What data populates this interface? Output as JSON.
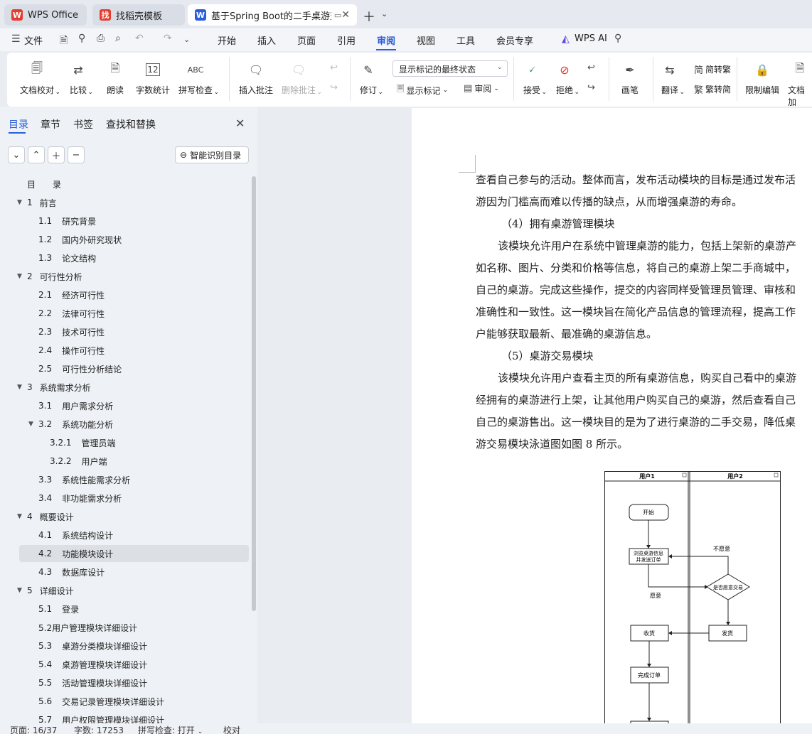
{
  "tabs": [
    {
      "label": "WPS Office",
      "logo": "W"
    },
    {
      "label": "找稻壳模板",
      "logo": "找"
    },
    {
      "label": "基于Spring Boot的二手桌游交",
      "logo": "W"
    }
  ],
  "menu": [
    "文件",
    "开始",
    "插入",
    "页面",
    "引用",
    "审阅",
    "视图",
    "工具",
    "会员专享",
    "WPS AI"
  ],
  "ribbon": {
    "doc_check": "文档校对",
    "compare": "比较",
    "read_aloud": "朗读",
    "word_count": "字数统计",
    "word_count_icon": "12",
    "spell_check": "拼写检查",
    "spell_icon": "ABC",
    "insert_comment": "插入批注",
    "delete_comment": "删除批注",
    "revise": "修订",
    "show_markup_select": "显示标记的最终状态",
    "show_markup": "显示标记",
    "review": "审阅",
    "accept": "接受",
    "reject": "拒绝",
    "draw": "画笔",
    "translate": "翻译",
    "to_traditional": "简转繁",
    "to_simplified": "繁转简",
    "restrict_edit": "限制编辑",
    "doc_extra": "文档加"
  },
  "sidebar": {
    "tabs": [
      "目录",
      "章节",
      "书签",
      "查找和替换"
    ],
    "smart_button": "智能识别目录",
    "toc": [
      {
        "num": "",
        "text": "目　　录",
        "level": 0,
        "tri": ""
      },
      {
        "num": "1",
        "text": "前言",
        "level": 0,
        "tri": "▼"
      },
      {
        "num": "1.1",
        "text": "研究背景",
        "level": 1,
        "tri": ""
      },
      {
        "num": "1.2",
        "text": "国内外研究现状",
        "level": 1,
        "tri": ""
      },
      {
        "num": "1.3",
        "text": "论文结构",
        "level": 1,
        "tri": ""
      },
      {
        "num": "2",
        "text": "可行性分析",
        "level": 0,
        "tri": "▼"
      },
      {
        "num": "2.1",
        "text": "经济可行性",
        "level": 1,
        "tri": ""
      },
      {
        "num": "2.2",
        "text": "法律可行性",
        "level": 1,
        "tri": ""
      },
      {
        "num": "2.3",
        "text": "技术可行性",
        "level": 1,
        "tri": ""
      },
      {
        "num": "2.4",
        "text": "操作可行性",
        "level": 1,
        "tri": ""
      },
      {
        "num": "2.5",
        "text": "可行性分析结论",
        "level": 1,
        "tri": ""
      },
      {
        "num": "3",
        "text": "系统需求分析",
        "level": 0,
        "tri": "▼"
      },
      {
        "num": "3.1",
        "text": "用户需求分析",
        "level": 1,
        "tri": ""
      },
      {
        "num": "3.2",
        "text": "系统功能分析",
        "level": 1,
        "tri": "▼"
      },
      {
        "num": "3.2.1",
        "text": "管理员端",
        "level": 2,
        "tri": ""
      },
      {
        "num": "3.2.2",
        "text": "用户端",
        "level": 2,
        "tri": ""
      },
      {
        "num": "3.3",
        "text": "系统性能需求分析",
        "level": 1,
        "tri": ""
      },
      {
        "num": "3.4",
        "text": "非功能需求分析",
        "level": 1,
        "tri": ""
      },
      {
        "num": "4",
        "text": "概要设计",
        "level": 0,
        "tri": "▼"
      },
      {
        "num": "4.1",
        "text": "系统结构设计",
        "level": 1,
        "tri": ""
      },
      {
        "num": "4.2",
        "text": "功能模块设计",
        "level": 1,
        "tri": ""
      },
      {
        "num": "4.3",
        "text": "数据库设计",
        "level": 1,
        "tri": ""
      },
      {
        "num": "5",
        "text": "详细设计",
        "level": 0,
        "tri": "▼"
      },
      {
        "num": "5.1",
        "text": "登录",
        "level": 1,
        "tri": ""
      },
      {
        "num": "",
        "text": "5.2用户管理模块详细设计",
        "level": 1,
        "tri": ""
      },
      {
        "num": "5.3",
        "text": "桌游分类模块详细设计",
        "level": 1,
        "tri": ""
      },
      {
        "num": "5.4",
        "text": "桌游管理模块详细设计",
        "level": 1,
        "tri": ""
      },
      {
        "num": "5.5",
        "text": "活动管理模块详细设计",
        "level": 1,
        "tri": ""
      },
      {
        "num": "5.6",
        "text": "交易记录管理模块详细设计",
        "level": 1,
        "tri": ""
      },
      {
        "num": "5.7",
        "text": "用户权限管理模块详细设计",
        "level": 1,
        "tri": ""
      }
    ]
  },
  "document": {
    "lines": [
      "查看自己参与的活动。整体而言，发布活动模块的目标是通过发布活",
      "游因为门槛高而难以传播的缺点，从而增强桌游的寿命。",
      "（4）拥有桌游管理模块",
      "该模块允许用户在系统中管理桌游的能力，包括上架新的桌游产",
      "如名称、图片、分类和价格等信息，将自己的桌游上架二手商城中，",
      "自己的桌游。完成这些操作，提交的内容同样受管理员管理、审核和",
      "准确性和一致性。这一模块旨在简化产品信息的管理流程，提高工作",
      "户能够获取最新、最准确的桌游信息。",
      "（5）桌游交易模块",
      "该模块允许用户查看主页的所有桌游信息，购买自己看中的桌游",
      "经拥有的桌游进行上架，让其他用户购买自己的桌游，然后查看自己",
      "自己的桌游售出。这一模块目的是为了进行桌游的二手交易，降低桌",
      "游交易模块泳道图如图 8 所示。"
    ],
    "flowchart": {
      "lane1": "用户1",
      "lane2": "用户2",
      "start": "开始",
      "browse_line1": "浏览桌游信息",
      "browse_line2": "并发送订单",
      "decision": "是否愿意交易",
      "disagree": "不愿意",
      "agree": "愿意",
      "ship": "发货",
      "receive": "收货",
      "complete": "完成订单"
    }
  },
  "status": {
    "page": "页面: 16/37",
    "words": "字数: 17253",
    "spell": "拼写检查: 打开",
    "proof": "校对"
  }
}
